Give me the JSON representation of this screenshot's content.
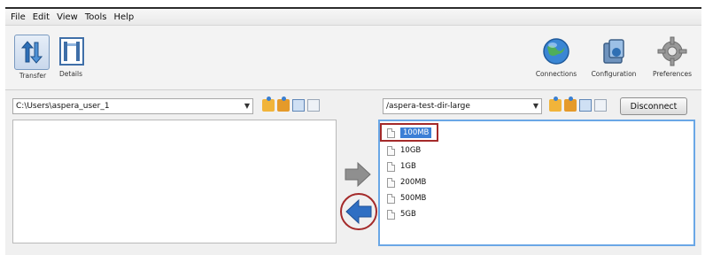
{
  "menu": [
    "File",
    "Edit",
    "View",
    "Tools",
    "Help"
  ],
  "toolbar": {
    "transfer_label": "Transfer",
    "details_label": "Details",
    "connections_label": "Connections",
    "configuration_label": "Configuration",
    "preferences_label": "Preferences"
  },
  "left_pane": {
    "path": "C:\\Users\\aspera_user_1"
  },
  "right_pane": {
    "path": "/aspera-test-dir-large",
    "disconnect_label": "Disconnect",
    "files": [
      "100MB",
      "10GB",
      "1GB",
      "200MB",
      "500MB",
      "5GB"
    ],
    "selected_file": "100MB"
  },
  "colors": {
    "selection": "#3b7fd6",
    "annotation": "#a42a2a",
    "pane_border_active": "#6aa7e6"
  },
  "icons": {
    "transfer": "transfer-arrows-icon",
    "details": "details-icon",
    "connections": "globe-icon",
    "configuration": "configuration-icon",
    "preferences": "gear-icon",
    "upload": "arrow-right-icon",
    "download": "arrow-left-icon"
  }
}
